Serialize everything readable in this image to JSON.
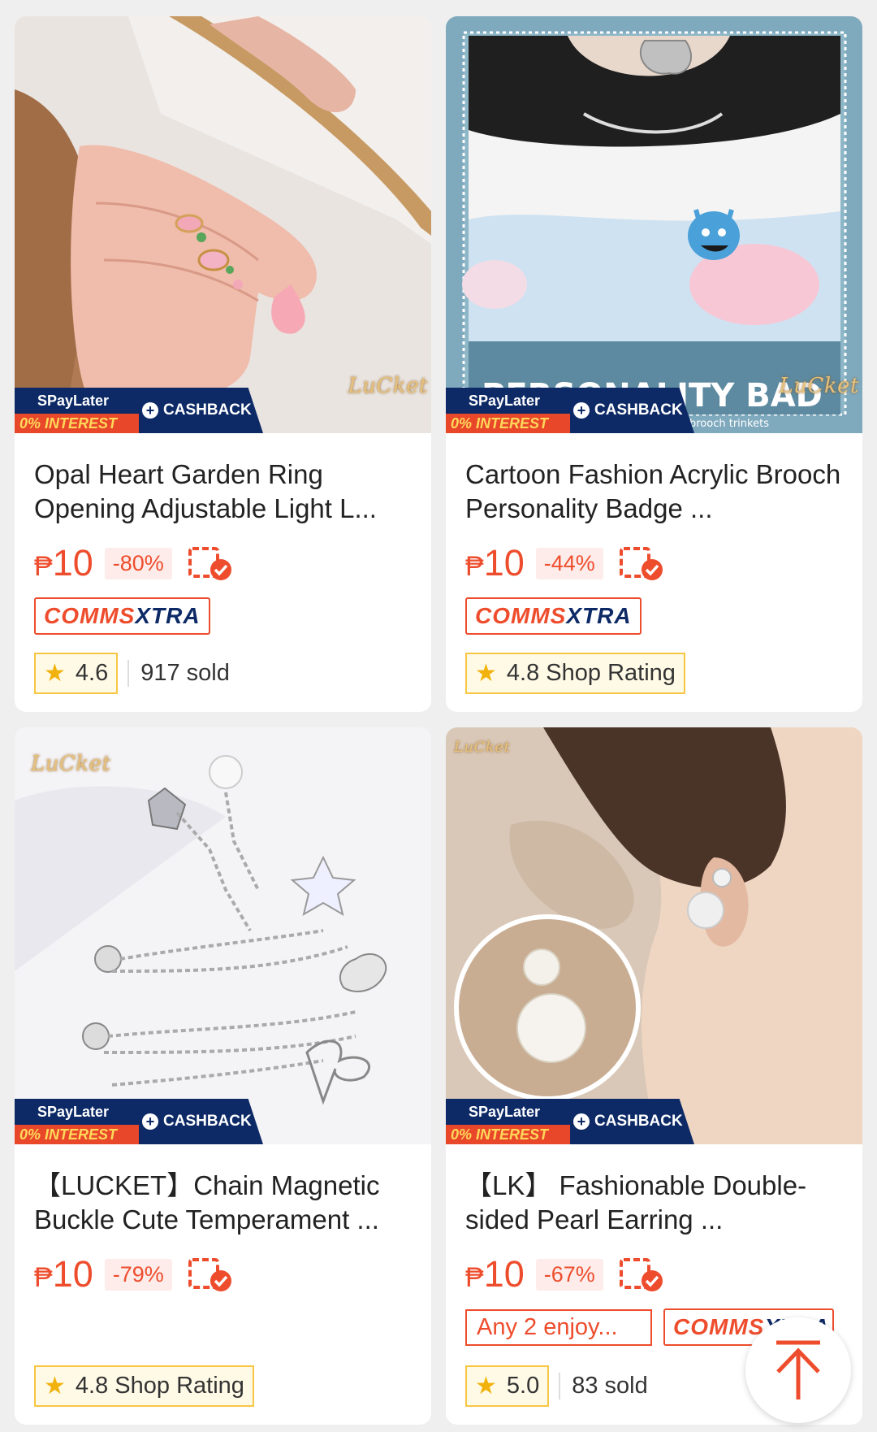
{
  "products": [
    {
      "title": "Opal Heart Garden Ring Opening Adjustable Light L...",
      "currency": "₱",
      "price": "10",
      "discount": "-80%",
      "comms_a": "COMMS",
      "comms_b": "XTRA",
      "rating": "4.6",
      "sold": "917 sold",
      "brand": "LuCket"
    },
    {
      "title": "Cartoon Fashion Acrylic Brooch Personality Badge ...",
      "currency": "₱",
      "price": "10",
      "discount": "-44%",
      "comms_a": "COMMS",
      "comms_b": "XTRA",
      "rating": "4.8 Shop Rating",
      "brand": "LuCket",
      "banner": "PERSONALITY BAD",
      "banner_sub": "brooch trinkets"
    },
    {
      "title": "【LUCKET】Chain Magnetic Buckle Cute Temperament ...",
      "currency": "₱",
      "price": "10",
      "discount": "-79%",
      "rating": "4.8 Shop Rating",
      "brand": "LuCket"
    },
    {
      "title": "【LK】 Fashionable Double-sided Pearl Earring ...",
      "currency": "₱",
      "price": "10",
      "discount": "-67%",
      "any_tag": "Any 2 enjoy...",
      "comms_a": "COMMS",
      "comms_b": "XTRA",
      "rating": "5.0",
      "sold": "83 sold",
      "brand": "LuCket"
    }
  ],
  "promo": {
    "spaylater": "SPayLater",
    "interest": "0% INTEREST",
    "cashback": "CASHBACK"
  },
  "colors": {
    "accent": "#ee4d2d",
    "navy": "#0d2a66",
    "star": "#f2b20d"
  },
  "icons": {
    "star": "★",
    "pay_later_check": "check-badge-icon",
    "back_to_top": "arrow-up-icon"
  }
}
